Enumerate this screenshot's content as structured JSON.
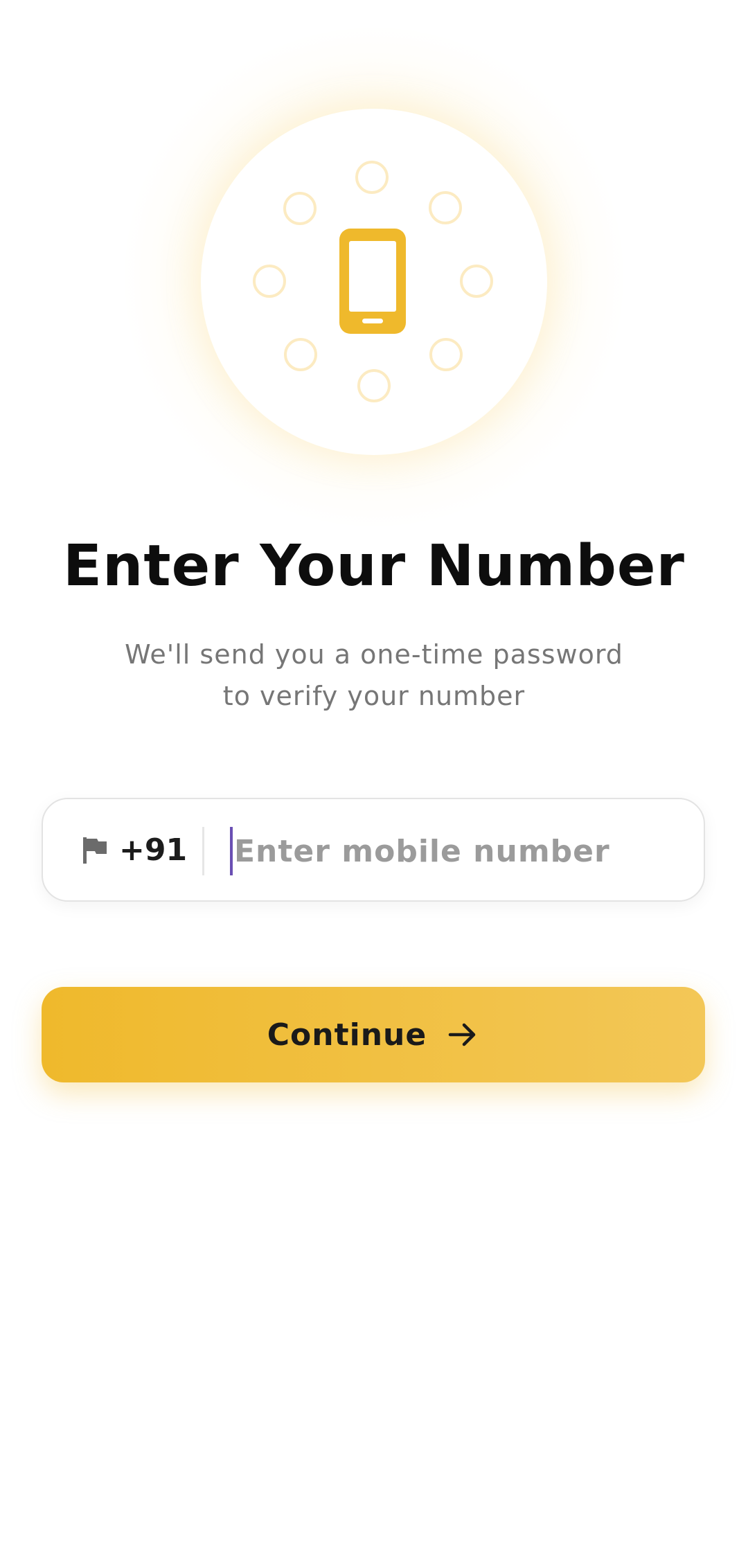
{
  "hero": {
    "icon": "smartphone-icon",
    "accent_color": "#EFB92C"
  },
  "header": {
    "title": "Enter Your Number",
    "subtitle_line1": "We'll send you a one-time password",
    "subtitle_line2": "to verify your number"
  },
  "phone_input": {
    "country_flag_icon": "flag-icon",
    "country_code": "+91",
    "value": "",
    "placeholder": "Enter mobile number"
  },
  "actions": {
    "continue_label": "Continue",
    "continue_icon": "arrow-right-icon"
  },
  "colors": {
    "accent": "#EFB92C",
    "caret": "#6A4FB3",
    "title": "#0D0D0D",
    "subtitle": "#767676"
  }
}
